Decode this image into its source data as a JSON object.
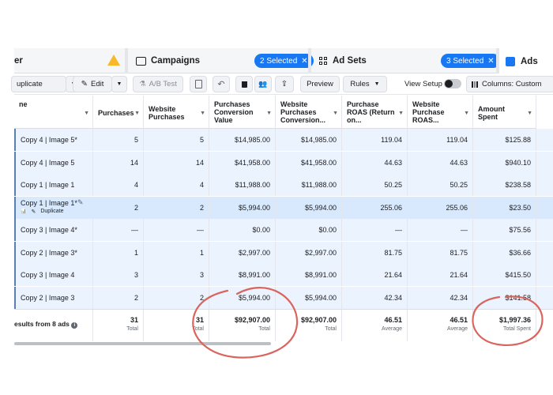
{
  "tabs": {
    "first_label": "er",
    "campaigns_label": "Campaigns",
    "campaigns_badge": "2 Selected",
    "adsets_label": "Ad Sets",
    "adsets_badge": "3 Selected",
    "ads_label": "Ads"
  },
  "toolbar": {
    "duplicate_label": "uplicate",
    "edit_label": "Edit",
    "abtest_label": "A/B Test",
    "preview_label": "Preview",
    "rules_label": "Rules",
    "view_setup_label": "View Setup",
    "columns_label": "Columns: Custom"
  },
  "table": {
    "headers": {
      "name": "ne",
      "purchases": "Purchases",
      "website_purchases": "Website Purchases",
      "conv_value": "Purchases Conversion Value",
      "web_conv": "Website Purchases Conversion...",
      "roas": "Purchase ROAS (Return on...",
      "web_roas": "Website Purchase ROAS...",
      "spent": "Amount Spent"
    },
    "rows": [
      {
        "name": "Copy 4 | Image 5*",
        "purchases": "5",
        "web_purchases": "5",
        "conv_value": "$14,985.00",
        "web_conv": "$14,985.00",
        "roas": "119.04",
        "web_roas": "119.04",
        "spent": "$125.88"
      },
      {
        "name": "Copy 4 | Image 5",
        "purchases": "14",
        "web_purchases": "14",
        "conv_value": "$41,958.00",
        "web_conv": "$41,958.00",
        "roas": "44.63",
        "web_roas": "44.63",
        "spent": "$940.10"
      },
      {
        "name": "Copy 1 | Image 1",
        "purchases": "4",
        "web_purchases": "4",
        "conv_value": "$11,988.00",
        "web_conv": "$11,988.00",
        "roas": "50.25",
        "web_roas": "50.25",
        "spent": "$238.58"
      },
      {
        "name": "Copy 1 | Image 1*",
        "purchases": "2",
        "web_purchases": "2",
        "conv_value": "$5,994.00",
        "web_conv": "$5,994.00",
        "roas": "255.06",
        "web_roas": "255.06",
        "spent": "$23.50"
      },
      {
        "name": "Copy 3 | Image 4*",
        "purchases": "—",
        "web_purchases": "—",
        "conv_value": "$0.00",
        "web_conv": "$0.00",
        "roas": "—",
        "web_roas": "—",
        "spent": "$75.56"
      },
      {
        "name": "Copy 2 | Image 3*",
        "purchases": "1",
        "web_purchases": "1",
        "conv_value": "$2,997.00",
        "web_conv": "$2,997.00",
        "roas": "81.75",
        "web_roas": "81.75",
        "spent": "$36.66"
      },
      {
        "name": "Copy 3 | Image 4",
        "purchases": "3",
        "web_purchases": "3",
        "conv_value": "$8,991.00",
        "web_conv": "$8,991.00",
        "roas": "21.64",
        "web_roas": "21.64",
        "spent": "$415.50"
      },
      {
        "name": "Copy 2 | Image 3",
        "purchases": "2",
        "web_purchases": "2",
        "conv_value": "$5,994.00",
        "web_conv": "$5,994.00",
        "roas": "42.34",
        "web_roas": "42.34",
        "spent": "$141.58"
      }
    ],
    "hover_duplicate_label": "Duplicate",
    "totals": {
      "label": "esults from 8 ads",
      "purchases": "31",
      "purchases_sub": "Total",
      "web_purchases": "31",
      "web_purchases_sub": "Total",
      "conv_value": "$92,907.00",
      "conv_value_sub": "Total",
      "web_conv": "$92,907.00",
      "web_conv_sub": "Total",
      "roas": "46.51",
      "roas_sub": "Average",
      "web_roas": "46.51",
      "web_roas_sub": "Average",
      "spent": "$1,997.36",
      "spent_sub": "Total Spent"
    }
  },
  "colors": {
    "accent": "#1877f2",
    "row_tint": "#ebf3fe",
    "row_selected": "#d8e8fd",
    "annotation": "#d9655e"
  }
}
